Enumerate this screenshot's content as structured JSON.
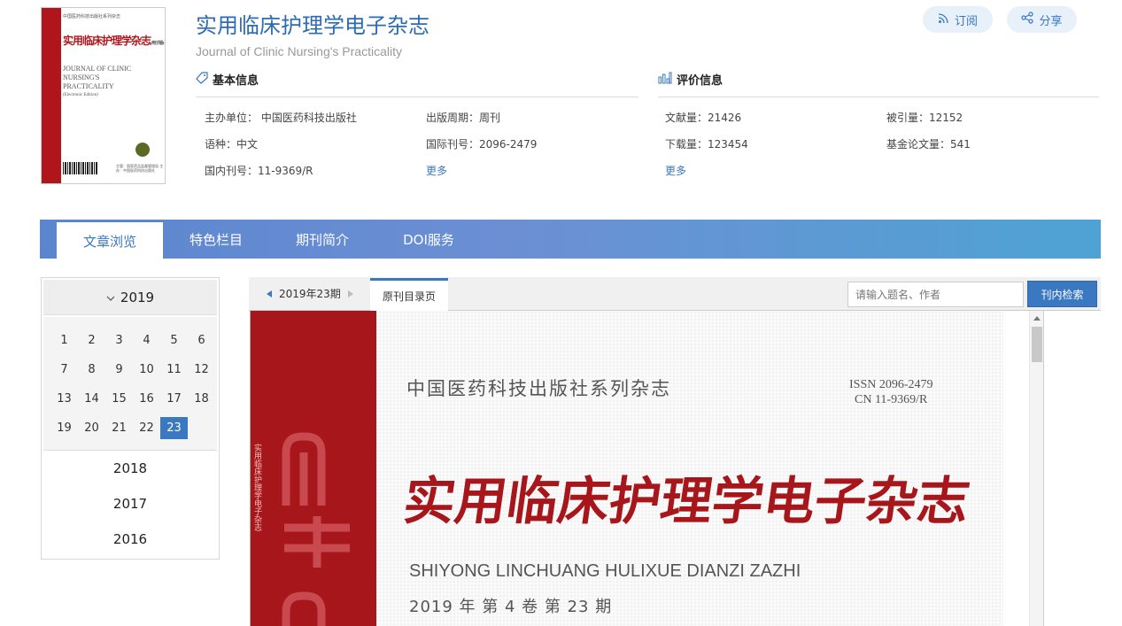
{
  "journal": {
    "title": "实用临床护理学电子杂志",
    "title_en": "Journal of Clinic Nursing's Practicality",
    "cover_thumb": {
      "top_line": "中国医药科技出版社系列杂志",
      "title": "实用临床护理学杂志",
      "title_tag": "(电子版)",
      "en_lines": "JOURNAL OF CLINIC NURSING'S PRACTICALITY",
      "en_sub": "(Electronic Edition)",
      "publisher": "主管：国家药品监督管理局 主办：中国医药科技出版社"
    }
  },
  "actions": {
    "subscribe": "订阅",
    "share": "分享"
  },
  "basic_info": {
    "heading": "基本信息",
    "sponsor": "主办单位： 中国医药科技出版社",
    "frequency": "出版周期：周刊",
    "language": "语种：中文",
    "issn": "国际刊号：2096-2479",
    "cn": "国内刊号：11-9369/R",
    "more": "更多"
  },
  "eval_info": {
    "heading": "评价信息",
    "literature_count": "文献量：21426",
    "citations": "被引量：12152",
    "downloads": "下载量：123454",
    "funded_papers": "基金论文量：541",
    "more": "更多"
  },
  "nav": {
    "tabs": [
      "文章浏览",
      "特色栏目",
      "期刊简介",
      "DOI服务"
    ],
    "active_index": 0
  },
  "years": {
    "current": "2019",
    "issues": [
      "1",
      "2",
      "3",
      "4",
      "5",
      "6",
      "7",
      "8",
      "9",
      "10",
      "11",
      "12",
      "13",
      "14",
      "15",
      "16",
      "17",
      "18",
      "19",
      "20",
      "21",
      "22",
      "23"
    ],
    "active_issue": "23",
    "others": [
      "2018",
      "2017",
      "2016"
    ]
  },
  "viewer": {
    "issue_label": "2019年23期",
    "tab": "原刊目录页",
    "search_placeholder": "请输入题名、作者",
    "search_button": "刊内检索"
  },
  "cover_page": {
    "series": "中国医药科技出版社系列杂志",
    "issn": "ISSN  2096-2479",
    "cn": "CN  11-9369/R",
    "title": "实用临床护理学电子杂志",
    "pinyin": "SHIYONG LINCHUANG HULIXUE DIANZI ZAZHI",
    "issue": "2019 年   第 4 卷   第 23 期",
    "spine_text": "实用临床护理学电子杂志"
  },
  "colors": {
    "accent": "#3a78c2",
    "title_blue": "#2d6bb3",
    "cover_red": "#a7161b"
  }
}
